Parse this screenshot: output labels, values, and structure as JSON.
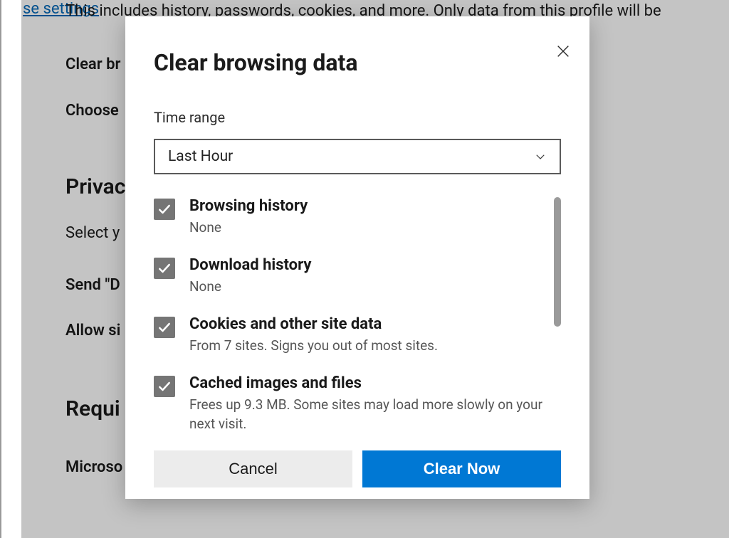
{
  "background": {
    "desc": "This includes history, passwords, cookies, and more. Only data from this profile will be",
    "clear_label": "Clear br",
    "choose_label": "Choose",
    "privacy_heading": "Privac",
    "select_label": "Select y",
    "link_se_settings": "se settings",
    "send_label": "Send \"D",
    "allow_label": "Allow si",
    "required_heading": "Requi",
    "micro_line": "Microso                                                                                                                                           secure, up to da expecte"
  },
  "dialog": {
    "title": "Clear browsing data",
    "time_range_label": "Time range",
    "time_range_value": "Last Hour",
    "items": [
      {
        "title": "Browsing history",
        "sub": "None",
        "checked": true
      },
      {
        "title": "Download history",
        "sub": "None",
        "checked": true
      },
      {
        "title": "Cookies and other site data",
        "sub": "From 7 sites. Signs you out of most sites.",
        "checked": true
      },
      {
        "title": "Cached images and files",
        "sub": "Frees up 9.3 MB. Some sites may load more slowly on your next visit.",
        "checked": true
      }
    ],
    "cancel_label": "Cancel",
    "clear_label": "Clear Now"
  }
}
